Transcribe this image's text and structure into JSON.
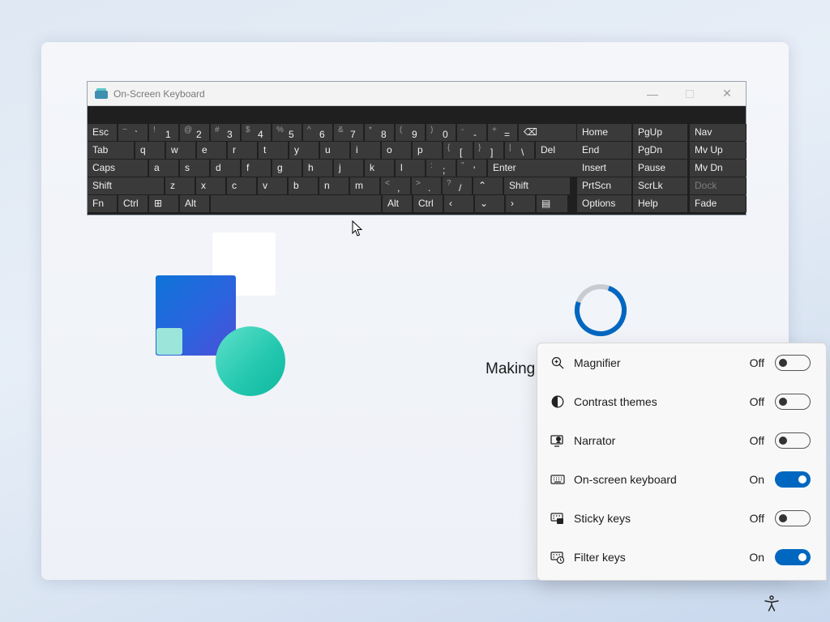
{
  "osk": {
    "title": "On-Screen Keyboard",
    "icons": {
      "app": "keyboard-app-icon",
      "minimize": "minimize-icon",
      "maximize": "maximize-icon",
      "close": "close-icon"
    },
    "rows": [
      [
        {
          "l": "Esc"
        },
        {
          "s": "~",
          "m": "`"
        },
        {
          "s": "!",
          "m": "1"
        },
        {
          "s": "@",
          "m": "2"
        },
        {
          "s": "#",
          "m": "3"
        },
        {
          "s": "$",
          "m": "4"
        },
        {
          "s": "%",
          "m": "5"
        },
        {
          "s": "^",
          "m": "6"
        },
        {
          "s": "&",
          "m": "7"
        },
        {
          "s": "*",
          "m": "8"
        },
        {
          "s": "(",
          "m": "9"
        },
        {
          "s": ")",
          "m": "0"
        },
        {
          "s": "-",
          "m": "-"
        },
        {
          "s": "+",
          "m": "="
        },
        {
          "l": "⌫"
        }
      ],
      [
        {
          "l": "Tab"
        },
        {
          "l": "q"
        },
        {
          "l": "w"
        },
        {
          "l": "e"
        },
        {
          "l": "r"
        },
        {
          "l": "t"
        },
        {
          "l": "y"
        },
        {
          "l": "u"
        },
        {
          "l": "i"
        },
        {
          "l": "o"
        },
        {
          "l": "p"
        },
        {
          "s": "{",
          "m": "["
        },
        {
          "s": "}",
          "m": "]"
        },
        {
          "s": "|",
          "m": "\\"
        },
        {
          "l": "Del"
        }
      ],
      [
        {
          "l": "Caps"
        },
        {
          "l": "a"
        },
        {
          "l": "s"
        },
        {
          "l": "d"
        },
        {
          "l": "f"
        },
        {
          "l": "g"
        },
        {
          "l": "h"
        },
        {
          "l": "j"
        },
        {
          "l": "k"
        },
        {
          "l": "l"
        },
        {
          "s": ":",
          "m": ";"
        },
        {
          "s": "\"",
          "m": "'"
        },
        {
          "l": "Enter"
        }
      ],
      [
        {
          "l": "Shift"
        },
        {
          "l": "z"
        },
        {
          "l": "x"
        },
        {
          "l": "c"
        },
        {
          "l": "v"
        },
        {
          "l": "b"
        },
        {
          "l": "n"
        },
        {
          "l": "m"
        },
        {
          "s": "<",
          "m": ","
        },
        {
          "s": ">",
          "m": "."
        },
        {
          "s": "?",
          "m": "/"
        },
        {
          "l": "⌃"
        },
        {
          "l": "Shift"
        }
      ],
      [
        {
          "l": "Fn"
        },
        {
          "l": "Ctrl"
        },
        {
          "l": "⊞"
        },
        {
          "l": "Alt"
        },
        {
          "l": ""
        },
        {
          "l": "Alt"
        },
        {
          "l": "Ctrl"
        },
        {
          "l": "‹"
        },
        {
          "l": "⌄"
        },
        {
          "l": "›"
        },
        {
          "l": "▤"
        }
      ]
    ],
    "nav": [
      [
        "Home",
        "PgUp",
        "Nav"
      ],
      [
        "End",
        "PgDn",
        "Mv Up"
      ],
      [
        "Insert",
        "Pause",
        "Mv Dn"
      ],
      [
        "PrtScn",
        "ScrLk",
        "Dock"
      ],
      [
        "Options",
        "Help",
        "Fade"
      ]
    ]
  },
  "oobe": {
    "status_text": "Making"
  },
  "accessibility": {
    "items": [
      {
        "label": "Magnifier",
        "state": "Off",
        "on": false,
        "icon": "magnifier-icon"
      },
      {
        "label": "Contrast themes",
        "state": "Off",
        "on": false,
        "icon": "contrast-icon"
      },
      {
        "label": "Narrator",
        "state": "Off",
        "on": false,
        "icon": "narrator-icon"
      },
      {
        "label": "On-screen keyboard",
        "state": "On",
        "on": true,
        "icon": "keyboard-icon"
      },
      {
        "label": "Sticky keys",
        "state": "Off",
        "on": false,
        "icon": "sticky-keys-icon"
      },
      {
        "label": "Filter keys",
        "state": "On",
        "on": true,
        "icon": "filter-keys-icon"
      }
    ],
    "accent_color": "#0067c0"
  },
  "taskbar": {
    "accessibility_button_icon": "accessibility-icon"
  }
}
